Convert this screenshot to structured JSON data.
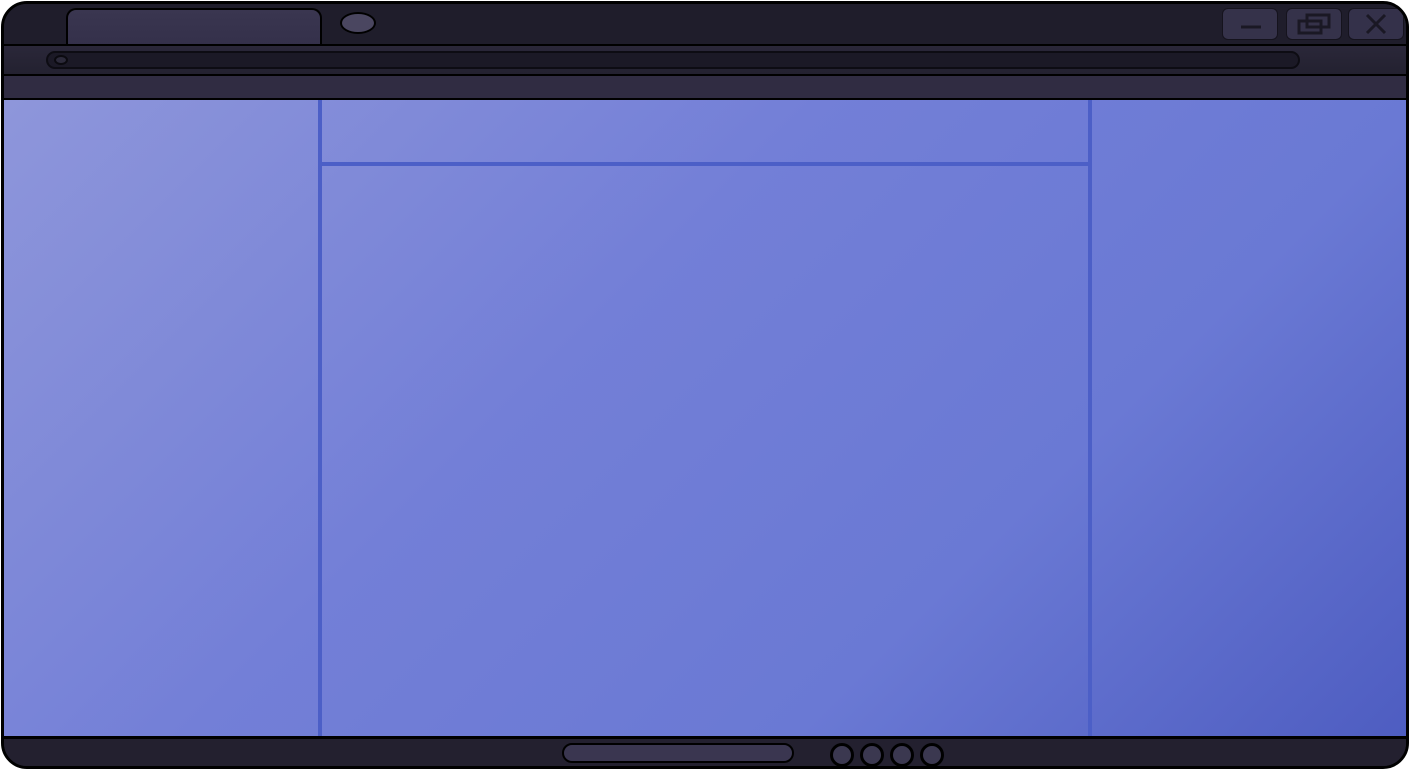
{
  "window": {
    "tab_title": "",
    "controls": {
      "minimize_icon": "minimize-icon",
      "maximize_icon": "restore-icon",
      "close_icon": "close-icon"
    }
  },
  "address_bar": {
    "value": "",
    "placeholder": ""
  },
  "content": {
    "center_header_text": "",
    "left_panel_text": "",
    "right_panel_text": ""
  },
  "status_bar": {
    "pager_dots": 4
  },
  "colors": {
    "chrome_dark": "#1f1d2b",
    "content_gradient_start": "#8e96da",
    "content_gradient_end": "#4e5dc1",
    "divider": "#4c5fc7"
  }
}
